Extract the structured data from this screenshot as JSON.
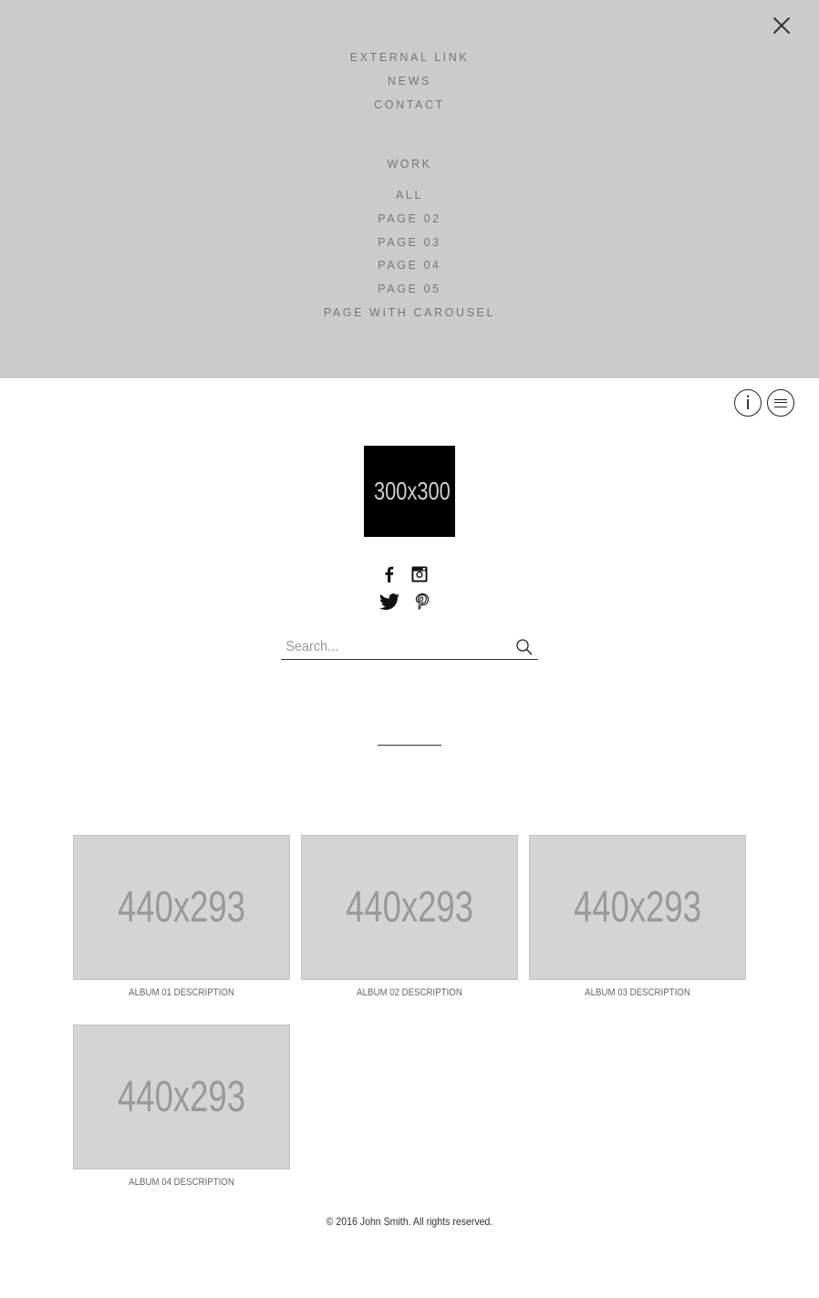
{
  "menu": {
    "close_icon": "close-icon",
    "top_items": [
      "EXTERNAL LINK",
      "NEWS",
      "CONTACT"
    ],
    "work_heading": "WORK",
    "work_items": [
      "ALL",
      "PAGE 02",
      "PAGE 03",
      "PAGE 04",
      "PAGE 05",
      "PAGE WITH CAROUSEL"
    ]
  },
  "header": {
    "info_icon": "info-icon",
    "menu_icon": "hamburger-menu-icon",
    "info_glyph": "i"
  },
  "logo": {
    "text": "300x300"
  },
  "social": {
    "icons": [
      "facebook-icon",
      "instagram-icon",
      "twitter-icon",
      "pinterest-icon"
    ]
  },
  "search": {
    "placeholder": "Search...",
    "icon": "search-icon"
  },
  "albums": [
    {
      "thumb_text": "440x293",
      "description": "ALBUM 01 DESCRIPTION"
    },
    {
      "thumb_text": "440x293",
      "description": "ALBUM 02 DESCRIPTION"
    },
    {
      "thumb_text": "440x293",
      "description": "ALBUM 03 DESCRIPTION"
    },
    {
      "thumb_text": "440x293",
      "description": "ALBUM 04 DESCRIPTION"
    }
  ],
  "footer": {
    "copyright": "© 2016 John Smith. All rights reserved."
  },
  "colors": {
    "menu_bg": "#cbcbcb",
    "thumb_bg": "#d4d4d4",
    "menu_text": "#777777"
  }
}
